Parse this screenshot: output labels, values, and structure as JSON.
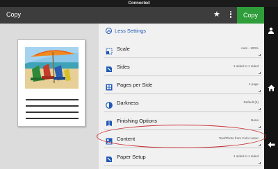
{
  "window": {
    "title": "Connected"
  },
  "appbar": {
    "title": "Copy",
    "action_label": "Copy",
    "star_icon": "star-icon",
    "menu_icon": "more-vert-icon"
  },
  "side_nav": [
    "user-icon",
    "home-icon",
    "back-icon"
  ],
  "settings": {
    "toggle_label": "Less Settings",
    "rows": [
      {
        "label": "Scale",
        "value": "Auto - 100%",
        "icon": "scale-icon"
      },
      {
        "label": "Sides",
        "value": "1 sided to 1 sided",
        "icon": "sides-icon"
      },
      {
        "label": "Pages per Side",
        "value": "1 page",
        "icon": "pages-per-side-icon"
      },
      {
        "label": "Darkness",
        "value": "Default (5)",
        "icon": "darkness-icon"
      },
      {
        "label": "Finishing Options",
        "value": "None",
        "icon": "finishing-icon"
      },
      {
        "label": "Content",
        "value": "Text/Photo from Color Laser",
        "icon": "content-icon"
      },
      {
        "label": "Paper Setup",
        "value": "1 sided to 1 sided",
        "icon": "paper-setup-icon"
      }
    ]
  },
  "colors": {
    "accent_green": "#2e9d3a",
    "link_blue": "#1f58b5",
    "highlight_red": "#c8262c"
  }
}
